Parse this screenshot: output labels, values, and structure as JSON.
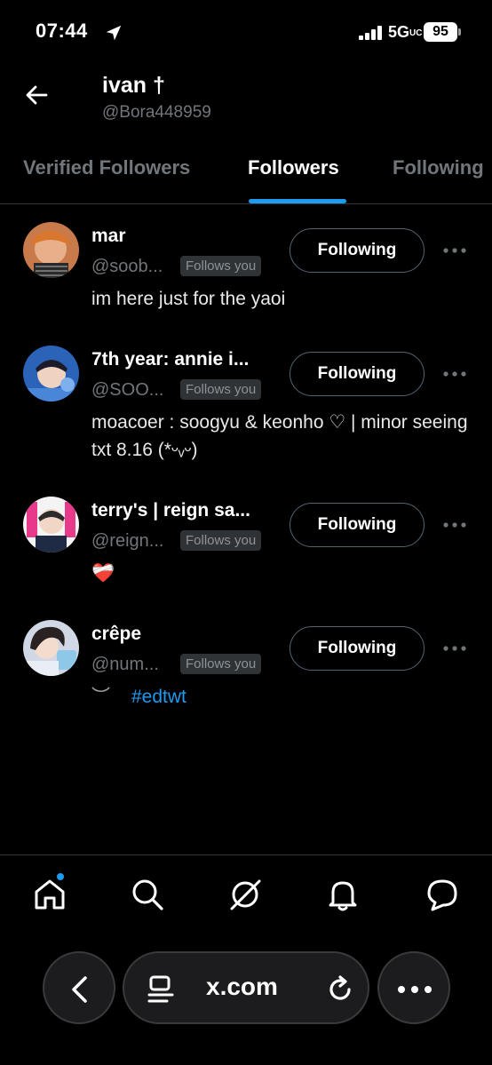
{
  "status_bar": {
    "time": "07:44",
    "network": "5G",
    "network_suffix": "UC",
    "battery": "95"
  },
  "header": {
    "name": "ivan †",
    "handle": "@Bora448959"
  },
  "tabs": [
    {
      "label": "Verified Followers"
    },
    {
      "label": "Followers",
      "active": true
    },
    {
      "label": "Following"
    }
  ],
  "followers": [
    {
      "name": "mar",
      "handle": "@soob...",
      "badge": "Follows you",
      "button": "Following",
      "bio": "im here just for the yaoi"
    },
    {
      "name": "7th year: annie i...",
      "handle": "@SOO...",
      "badge": "Follows you",
      "button": "Following",
      "bio": "moacoer : soogyu & keonho ♡ | minor seeing txt 8.16 (*ᵕᵥᵕ)"
    },
    {
      "name": "terry's | reign sa...",
      "handle": "@reign...",
      "badge": "Follows you",
      "button": "Following",
      "bio": "❤️‍🩹"
    },
    {
      "name": "crêpe",
      "handle": "@num...",
      "badge": "Follows you",
      "button": "Following",
      "bio_prefix": "︶",
      "bio_hashtag": "#edtwt"
    }
  ],
  "bottom_nav": [
    "home-icon",
    "search-icon",
    "grok-icon",
    "notifications-icon",
    "messages-icon"
  ],
  "browser": {
    "url": "x.com"
  },
  "colors": {
    "accent": "#1d9bf0",
    "background": "#000000",
    "secondary_text": "#71767b"
  }
}
